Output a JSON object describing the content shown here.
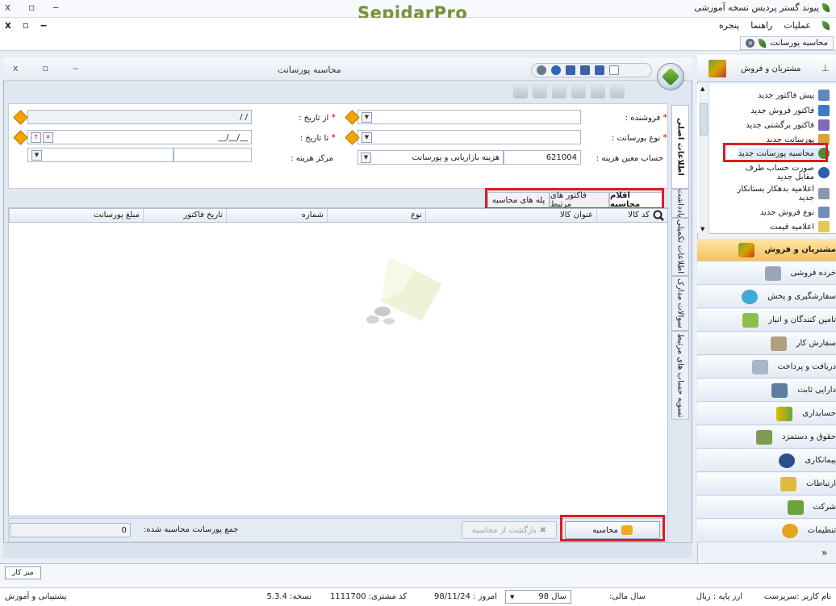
{
  "window": {
    "app_title": "پیوند گستر پردیس نسخه آموزشی",
    "logo": "SepidarPro",
    "controls": [
      "x",
      "▫",
      "‒"
    ],
    "mdi_controls": [
      "x",
      "▫",
      "‒"
    ]
  },
  "menubar": {
    "items": [
      "عملیات",
      "راهنما",
      "پنجره"
    ]
  },
  "doc_tab": {
    "label": "محاسبه پورسانت"
  },
  "inner_window": {
    "title": "محاسبه پورسانت",
    "controls": [
      "x",
      "▫",
      "‒"
    ]
  },
  "form": {
    "seller_label": "فروشنده :",
    "from_date_label": "از تاریخ :",
    "from_date_value": "/ /",
    "commission_type_label": "نوع پورسانت :",
    "to_date_label": "تا تاریخ :",
    "to_date_value": "__/__/__",
    "account_label": "حساب معین هزینه :",
    "account_code": "621004",
    "account_name": "هزینه بازاریابی و پورسانت",
    "cost_center_label": "مرکز هزینه :",
    "required_mark": "*"
  },
  "side_tabs": [
    "اطلاعات اصلی",
    "یادداشت",
    "اطلاعات تکمیلی",
    "سوالات مدارک",
    "تسویه حساب های مرتبط"
  ],
  "tabs": [
    "اقلام محاسبه",
    "فاکتور های مرتبط",
    "پله های محاسبه"
  ],
  "grid": {
    "columns": [
      "کد کالا",
      "عنوان کالا",
      "نوع",
      "شماره",
      "تاریخ فاکتور",
      "مبلغ پورسانت"
    ]
  },
  "bottom": {
    "calculate_label": "محاسبه",
    "back_label": "بازگشت از محاسبه",
    "sum_label": "جمع پورسانت محاسبه شده:",
    "sum_value": "0"
  },
  "nav": {
    "header": "مشتریان و فروش",
    "items": [
      "پیش فاکتور جدید",
      "فاکتور فروش جدید",
      "فاکتور برگشتی جدید",
      "پورسانت جدید",
      "محاسبه پورسانت جدید",
      "صورت حساب طرف مقابل جدید",
      "اعلامیه بدهکار بستانکار جدید",
      "نوع فروش جدید",
      "اعلامیه قیمت"
    ],
    "modules": [
      "مشتریان و فروش",
      "خرده فروشی",
      "سفارشگیری و پخش",
      "تامین کنندگان و انبار",
      "سفارش کار",
      "دریافت و پرداخت",
      "دارایی ثابت",
      "حسابداری",
      "حقوق و دستمزد",
      "پیمانکاری",
      "ارتباطات",
      "شرکت",
      "تنظیمات"
    ],
    "expand": "»"
  },
  "desktop": {
    "button": "میز کار"
  },
  "status": {
    "user": "نام کاربر :سرپرست",
    "base_currency": "ارز پایه : ریال",
    "fiscal_year_label": "سال مالی:",
    "fiscal_year_value": "سال 98",
    "today": "امروز : 98/11/24",
    "customer_code": "کد مشتری: 1111700",
    "version": "نسخه: 5.3.4",
    "support": "پشتیبانی و آموزش"
  },
  "colors": {
    "highlight_red": "#d81e24",
    "active_module": "#f6c15a",
    "logo_green": "#7a8f3c"
  }
}
